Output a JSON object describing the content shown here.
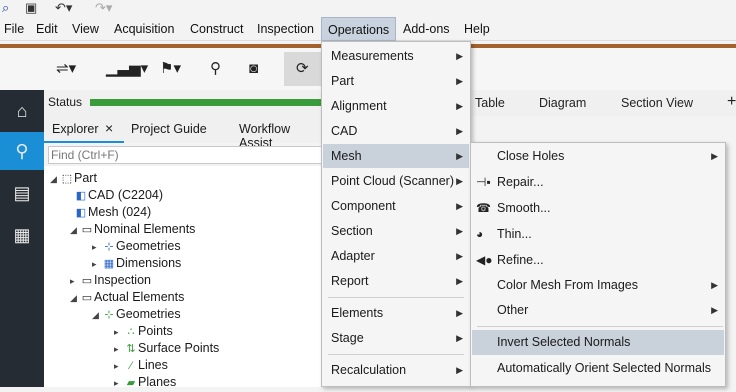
{
  "quickbar": {
    "icons": [
      "app-icon",
      "save-icon",
      "undo-icon",
      "redo-icon"
    ]
  },
  "menubar": {
    "items": [
      "File",
      "Edit",
      "View",
      "Acquisition",
      "Construct",
      "Inspection",
      "Operations",
      "Add-ons",
      "Help"
    ],
    "open_item": "Operations"
  },
  "colors": {
    "brand": "#a3612c",
    "accent": "#1a8fd6",
    "progress": "#3a9b3a",
    "highlight": "#c9d1db",
    "rail": "#262c33"
  },
  "toolbar": {
    "icons": [
      "alignment-icon",
      "chart-icon",
      "flag-icon",
      "search-icon",
      "camera-icon",
      "refresh-icon"
    ]
  },
  "rail": {
    "icons": [
      "home-icon",
      "search-icon",
      "document-icon",
      "grid-icon"
    ]
  },
  "status": {
    "label": "Status",
    "progress": 1.0
  },
  "right_tabs": [
    "Table",
    "Diagram",
    "Section View",
    "+"
  ],
  "panel_tabs": [
    "Explorer",
    "×",
    "Project Guide",
    "Workflow Assist"
  ],
  "find": {
    "placeholder": "Find (Ctrl+F)"
  },
  "tree": [
    {
      "label": "Part"
    },
    {
      "label": "CAD (C2204)"
    },
    {
      "label": "Mesh (024)"
    },
    {
      "label": "Nominal Elements"
    },
    {
      "label": "Geometries"
    },
    {
      "label": "Dimensions"
    },
    {
      "label": "Inspection"
    },
    {
      "label": "Actual Elements"
    },
    {
      "label": "Geometries"
    },
    {
      "label": "Points"
    },
    {
      "label": "Surface Points"
    },
    {
      "label": "Lines"
    },
    {
      "label": "Planes"
    }
  ],
  "operations_menu": {
    "items": [
      "Measurements",
      "Part",
      "Alignment",
      "CAD",
      "Mesh",
      "Point Cloud (Scanner)",
      "Component",
      "Section",
      "Adapter",
      "Report",
      "Elements",
      "Stage",
      "Recalculation"
    ],
    "highlighted": "Mesh"
  },
  "mesh_menu": {
    "items": [
      "Close Holes",
      "Repair...",
      "Smooth...",
      "Thin...",
      "Refine...",
      "Color Mesh From Images",
      "Other",
      "Invert Selected Normals",
      "Automatically Orient Selected Normals"
    ],
    "highlighted": "Invert Selected Normals"
  }
}
